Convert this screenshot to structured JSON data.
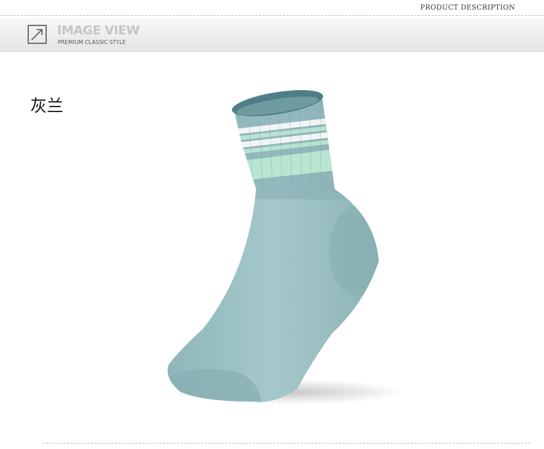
{
  "header": {
    "section_label": "PRODUCT DESCRIPTION"
  },
  "banner": {
    "icon": "arrow-up-right-icon",
    "title": "IMAGE VIEW",
    "subtitle": "PREMIUM CLASSIC STYLE"
  },
  "product": {
    "color_name": "灰兰",
    "image": "blue-gray-sock-photo",
    "colors": {
      "body": "#9cc1c4",
      "stripe": "#b8e6d1",
      "cuff": "#82abb0"
    }
  }
}
